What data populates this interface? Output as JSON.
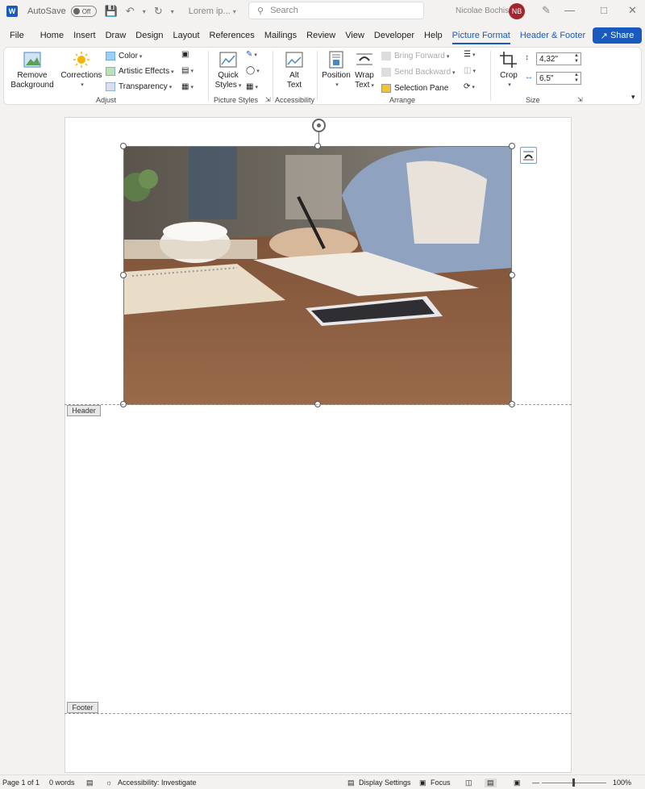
{
  "titlebar": {
    "app_logo": "W",
    "autosave_label": "AutoSave",
    "autosave_state": "Off",
    "doc_name": "Lorem ip...",
    "search_placeholder": "Search",
    "user_name": "Nicolae Bochis",
    "user_initials": "NB"
  },
  "tabs": [
    "File",
    "Home",
    "Insert",
    "Draw",
    "Design",
    "Layout",
    "References",
    "Mailings",
    "Review",
    "View",
    "Developer",
    "Help",
    "Picture Format",
    "Header & Footer"
  ],
  "active_tab": "Picture Format",
  "share_label": "Share",
  "ribbon": {
    "adjust": {
      "label": "Adjust",
      "remove_bg_1": "Remove",
      "remove_bg_2": "Background",
      "corrections": "Corrections",
      "color": "Color",
      "artistic": "Artistic Effects",
      "transparency": "Transparency"
    },
    "picture_styles": {
      "label": "Picture Styles",
      "quick_1": "Quick",
      "quick_2": "Styles"
    },
    "accessibility": {
      "label": "Accessibility",
      "alt_1": "Alt",
      "alt_2": "Text"
    },
    "arrange": {
      "label": "Arrange",
      "position": "Position",
      "wrap_1": "Wrap",
      "wrap_2": "Text",
      "bring_forward": "Bring Forward",
      "send_backward": "Send Backward",
      "selection_pane": "Selection Pane"
    },
    "size": {
      "label": "Size",
      "crop": "Crop",
      "height": "4,32\"",
      "width": "6,5\""
    }
  },
  "document": {
    "header_tag": "Header",
    "footer_tag": "Footer"
  },
  "status": {
    "page": "Page 1 of 1",
    "words": "0 words",
    "accessibility": "Accessibility: Investigate",
    "display_settings": "Display Settings",
    "focus": "Focus",
    "zoom": "100%"
  },
  "colors": {
    "accent": "#185abd",
    "avatar": "#a4262c"
  }
}
